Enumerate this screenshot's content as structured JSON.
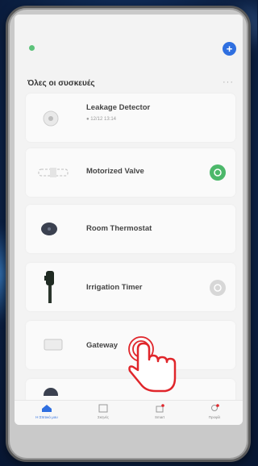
{
  "header": {
    "title": "Όλες οι συσκευές",
    "more_label": "···",
    "add_label": "+"
  },
  "devices": [
    {
      "name": "Leakage Detector",
      "subtitle": "12/12 13:14",
      "icon": "leak-sensor-icon",
      "toggle": "none"
    },
    {
      "name": "Motorized Valve",
      "subtitle": "",
      "icon": "valve-icon",
      "toggle": "on",
      "toggle_color": "#4cb86a"
    },
    {
      "name": "Room Thermostat",
      "subtitle": "",
      "icon": "thermostat-icon",
      "toggle": "none"
    },
    {
      "name": "Irrigation Timer",
      "subtitle": "",
      "icon": "irrigation-icon",
      "toggle": "off",
      "toggle_color": "#d7d7d7"
    },
    {
      "name": "Gateway",
      "subtitle": "",
      "icon": "gateway-icon",
      "toggle": "none"
    }
  ],
  "tabs": [
    {
      "label": "Η Σπιτικό μου",
      "icon": "home-icon",
      "active": true
    },
    {
      "label": "Σκηνές",
      "icon": "scenes-icon",
      "active": false
    },
    {
      "label": "Smart",
      "icon": "smart-icon",
      "active": false
    },
    {
      "label": "Προφίλ",
      "icon": "profile-icon",
      "active": false
    }
  ],
  "colors": {
    "accent": "#2f6fe0",
    "toggle_on": "#4cb86a",
    "pointer": "#e0262b"
  },
  "overlay": {
    "pointer_icon": "tap-hand-icon"
  }
}
